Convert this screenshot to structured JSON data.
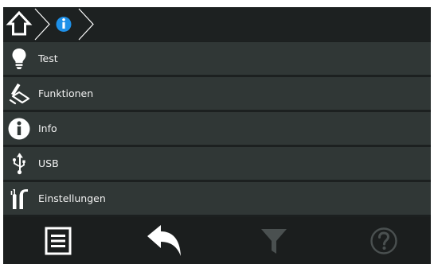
{
  "breadcrumb": {
    "items": [
      {
        "icon": "home-icon"
      },
      {
        "icon": "info-icon"
      }
    ],
    "info_icon_color": "#1e90e8"
  },
  "menu": {
    "items": [
      {
        "label": "Test",
        "icon": "lightbulb-icon"
      },
      {
        "label": "Funktionen",
        "icon": "functions-icon"
      },
      {
        "label": "Info",
        "icon": "info-icon"
      },
      {
        "label": "USB",
        "icon": "usb-icon"
      },
      {
        "label": "Einstellungen",
        "icon": "tools-icon"
      }
    ]
  },
  "toolbar": {
    "buttons": [
      {
        "icon": "menu-list-icon",
        "enabled": true
      },
      {
        "icon": "back-arrow-icon",
        "enabled": true
      },
      {
        "icon": "filter-icon",
        "enabled": false
      },
      {
        "icon": "help-icon",
        "enabled": false
      }
    ]
  },
  "colors": {
    "background": "#1c2020",
    "menu_item": "#303736",
    "text": "#f2f2f2",
    "disabled_icon": "#4a5050",
    "accent": "#1e90e8"
  }
}
